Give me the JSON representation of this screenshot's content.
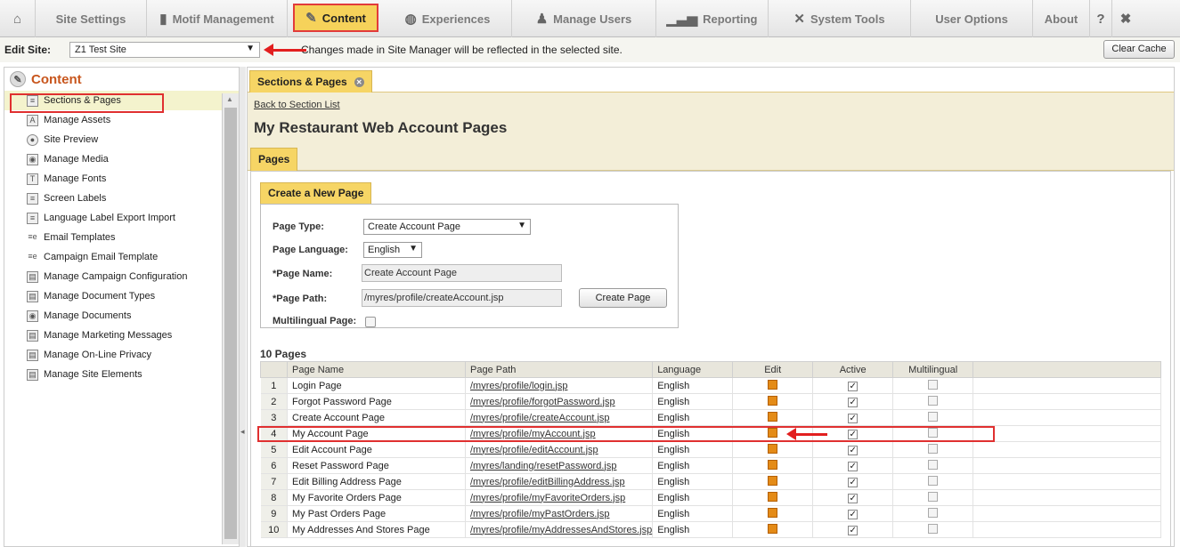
{
  "nav": {
    "home_icon": "home-icon",
    "items": [
      {
        "label": "Site Settings",
        "icon": ""
      },
      {
        "label": "Motif Management",
        "icon": "book-icon"
      },
      {
        "label": "Content",
        "icon": "edit-icon"
      },
      {
        "label": "Experiences",
        "icon": "globe-icon"
      },
      {
        "label": "Manage Users",
        "icon": "users-icon"
      },
      {
        "label": "Reporting",
        "icon": "chart-icon"
      },
      {
        "label": "System Tools",
        "icon": "tools-icon"
      },
      {
        "label": "User Options",
        "icon": ""
      },
      {
        "label": "About",
        "icon": ""
      }
    ],
    "help_icon": "?",
    "close_icon": "✖"
  },
  "sitebar": {
    "label": "Edit Site:",
    "site_value": "Z1 Test Site",
    "message": "Changes made in Site Manager will be reflected in the selected site.",
    "clear_cache_label": "Clear Cache"
  },
  "sidebar": {
    "title": "Content",
    "items": [
      {
        "label": "Sections & Pages",
        "icon": "page-icon"
      },
      {
        "label": "Manage Assets",
        "icon": "asset-icon"
      },
      {
        "label": "Site Preview",
        "icon": "magnifier-icon"
      },
      {
        "label": "Manage Media",
        "icon": "media-icon"
      },
      {
        "label": "Manage Fonts",
        "icon": "font-icon"
      },
      {
        "label": "Screen Labels",
        "icon": "page-icon"
      },
      {
        "label": "Language Label Export Import",
        "icon": "page-icon"
      },
      {
        "label": "Email Templates",
        "icon": "email-icon"
      },
      {
        "label": "Campaign Email Template",
        "icon": "email-icon"
      },
      {
        "label": "Manage Campaign Configuration",
        "icon": "cabinet-icon"
      },
      {
        "label": "Manage Document Types",
        "icon": "cabinet-icon"
      },
      {
        "label": "Manage Documents",
        "icon": "media-icon"
      },
      {
        "label": "Manage Marketing Messages",
        "icon": "cabinet-icon"
      },
      {
        "label": "Manage On-Line Privacy",
        "icon": "cabinet-icon"
      },
      {
        "label": "Manage Site Elements",
        "icon": "cabinet-icon"
      }
    ]
  },
  "main": {
    "tab_label": "Sections & Pages",
    "back_link": "Back to Section List",
    "page_title": "My Restaurant Web Account Pages",
    "pages_tab": "Pages",
    "create_tab": "Create a New Page",
    "form": {
      "page_type_label": "Page Type:",
      "page_type_value": "Create Account Page",
      "language_label": "Page Language:",
      "language_value": "English",
      "name_label": "*Page Name:",
      "name_value": "Create Account Page",
      "path_label": "*Page Path:",
      "path_value": "/myres/profile/createAccount.jsp",
      "create_button": "Create Page",
      "multilingual_label": "Multilingual Page:"
    },
    "count_label": "10 Pages",
    "table": {
      "headers": [
        "",
        "Page Name",
        "Page Path",
        "Language",
        "Edit",
        "Active",
        "Multilingual"
      ],
      "rows": [
        {
          "num": "1",
          "name": "Login Page",
          "path": "/myres/profile/login.jsp",
          "language": "English"
        },
        {
          "num": "2",
          "name": "Forgot Password Page",
          "path": "/myres/profile/forgotPassword.jsp",
          "language": "English"
        },
        {
          "num": "3",
          "name": "Create Account Page",
          "path": "/myres/profile/createAccount.jsp",
          "language": "English"
        },
        {
          "num": "4",
          "name": "My Account Page",
          "path": "/myres/profile/myAccount.jsp",
          "language": "English"
        },
        {
          "num": "5",
          "name": "Edit Account Page",
          "path": "/myres/profile/editAccount.jsp",
          "language": "English"
        },
        {
          "num": "6",
          "name": "Reset Password Page",
          "path": "/myres/landing/resetPassword.jsp",
          "language": "English"
        },
        {
          "num": "7",
          "name": "Edit Billing Address Page",
          "path": "/myres/profile/editBillingAddress.jsp",
          "language": "English"
        },
        {
          "num": "8",
          "name": "My Favorite Orders Page",
          "path": "/myres/profile/myFavoriteOrders.jsp",
          "language": "English"
        },
        {
          "num": "9",
          "name": "My Past Orders Page",
          "path": "/myres/profile/myPastOrders.jsp",
          "language": "English"
        },
        {
          "num": "10",
          "name": "My Addresses And Stores Page",
          "path": "/myres/profile/myAddressesAndStores.jsp",
          "language": "English"
        }
      ]
    }
  }
}
